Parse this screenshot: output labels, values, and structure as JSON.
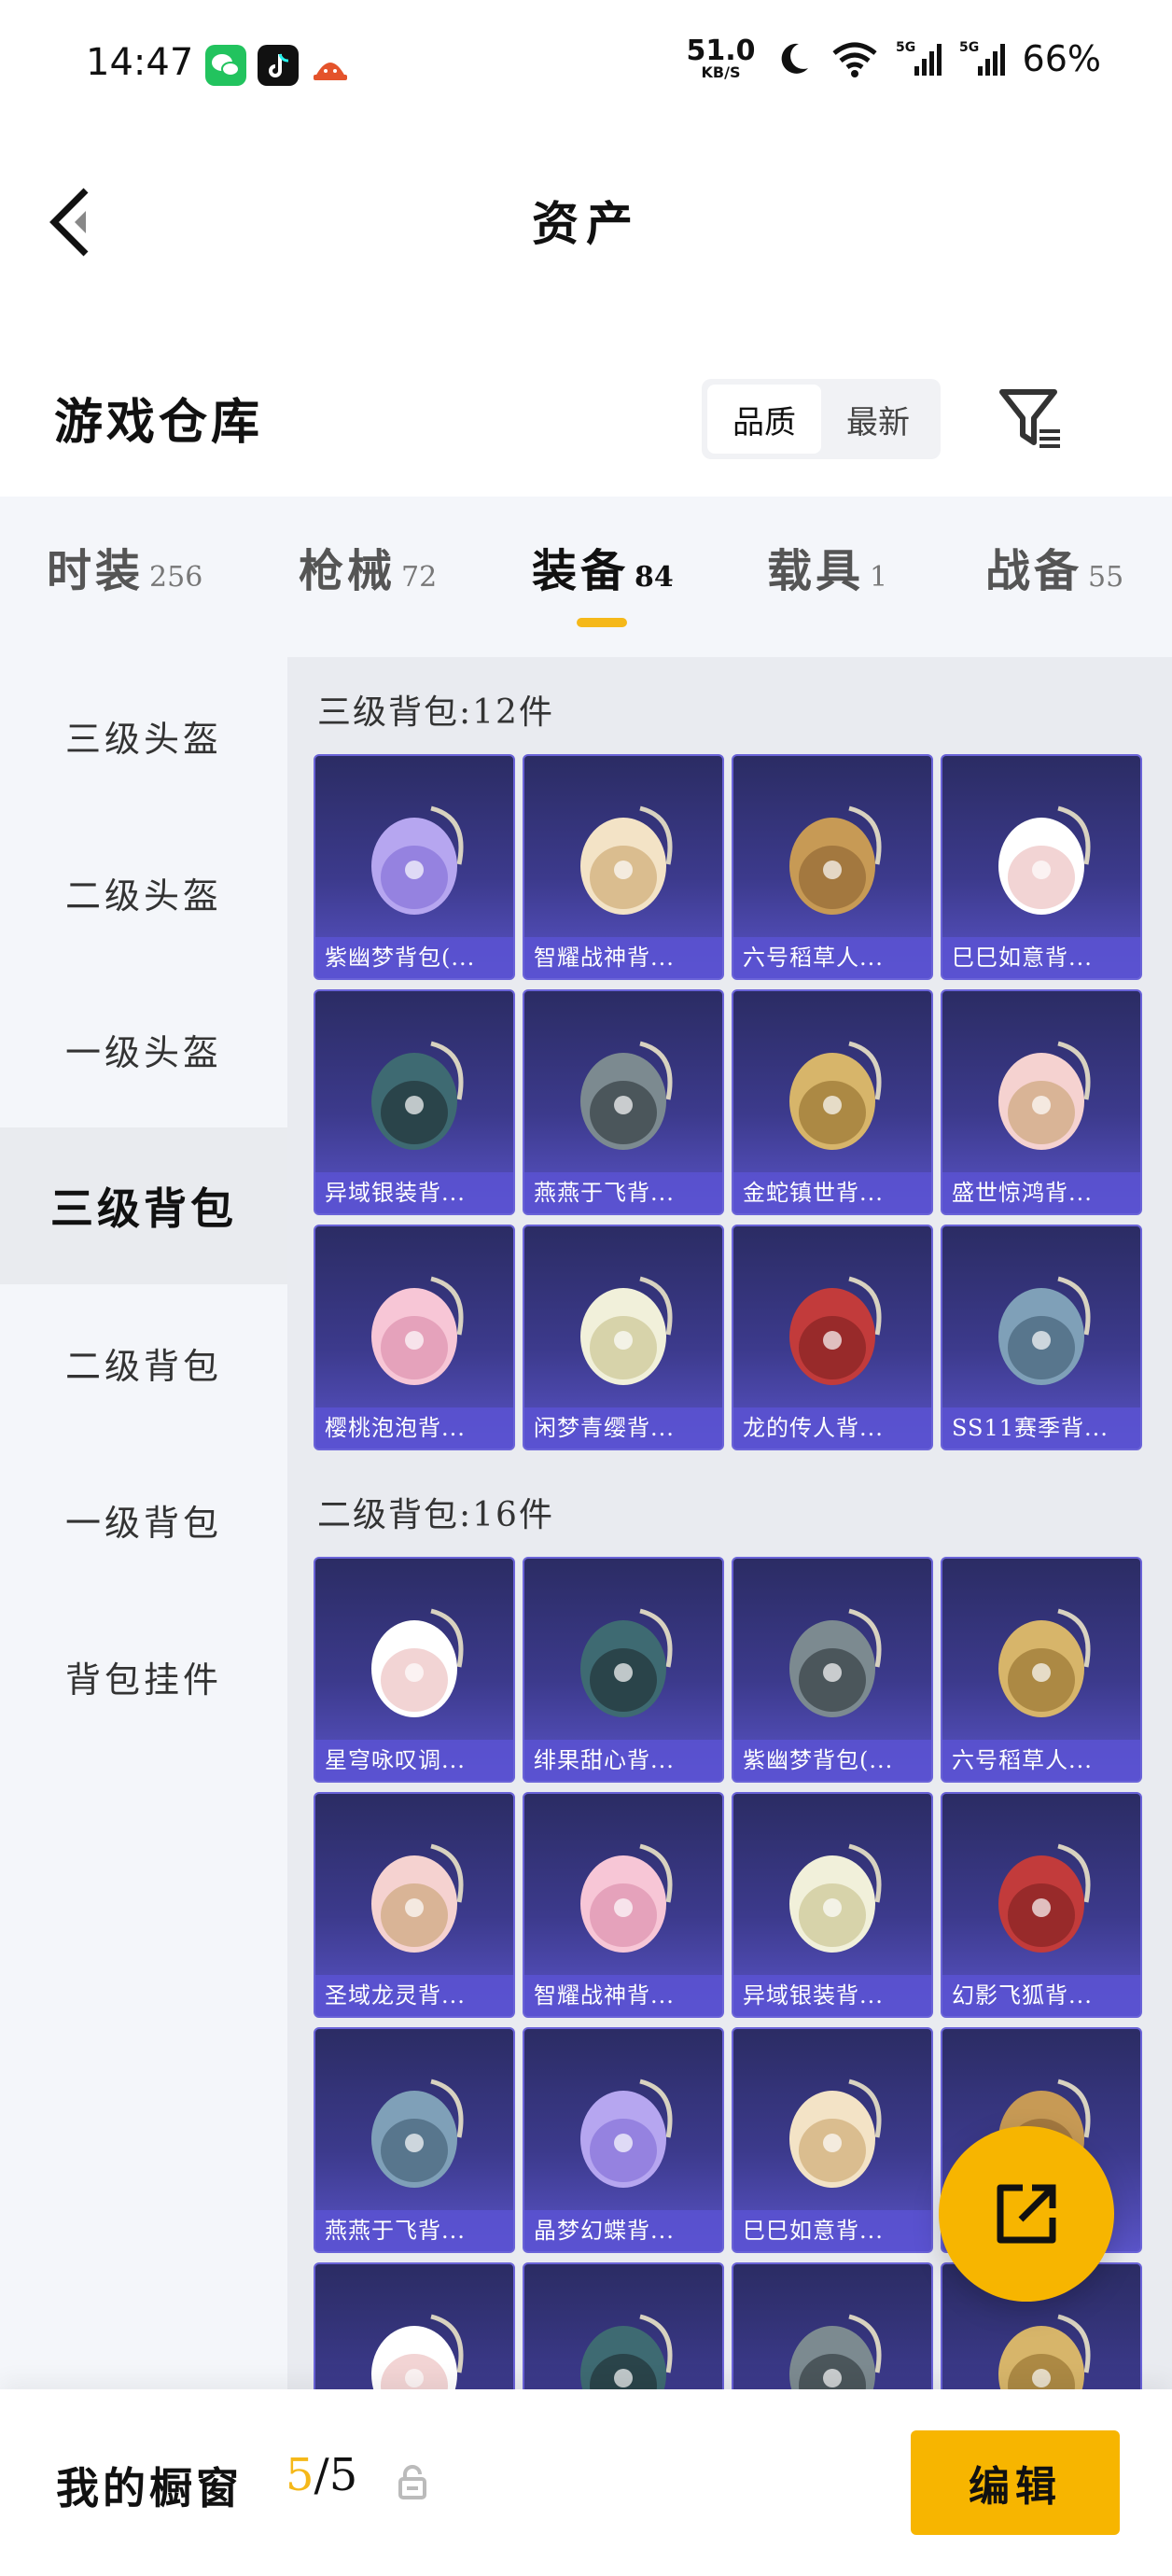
{
  "status_bar": {
    "time": "14:47",
    "net_speed": "51.0",
    "net_unit": "KB/S",
    "signal1": "5G",
    "signal2": "5G",
    "battery": "66%"
  },
  "header": {
    "title": "资产"
  },
  "warehouse": {
    "title": "游戏仓库",
    "sort_options": [
      "品质",
      "最新"
    ],
    "sort_active": "品质"
  },
  "category_tabs": [
    {
      "name": "时装",
      "count": "256"
    },
    {
      "name": "枪械",
      "count": "72"
    },
    {
      "name": "装备",
      "count": "84"
    },
    {
      "name": "载具",
      "count": "1"
    },
    {
      "name": "战备",
      "count": "55"
    }
  ],
  "active_tab": "装备",
  "sidebar": {
    "items": [
      "三级头盔",
      "二级头盔",
      "一级头盔",
      "三级背包",
      "二级背包",
      "一级背包",
      "背包挂件"
    ],
    "active": "三级背包"
  },
  "sections": [
    {
      "title": "三级背包:12件",
      "items": [
        "紫幽梦背包(...",
        "智耀战神背...",
        "六号稻草人...",
        "巳巳如意背...",
        "异域银装背...",
        "燕燕于飞背...",
        "金蛇镇世背...",
        "盛世惊鸿背...",
        "樱桃泡泡背...",
        "闲梦青缨背...",
        "龙的传人背...",
        "SS11赛季背..."
      ]
    },
    {
      "title": "二级背包:16件",
      "items": [
        "星穹咏叹调...",
        "绯果甜心背...",
        "紫幽梦背包(...",
        "六号稻草人...",
        "圣域龙灵背...",
        "智耀战神背...",
        "异域银装背...",
        "幻影飞狐背...",
        "燕燕于飞背...",
        "晶梦幻蝶背...",
        "巳巳如意背...",
        "",
        "",
        "",
        "",
        ""
      ]
    }
  ],
  "bottom": {
    "showcase_label": "我的橱窗",
    "showcase_current": "5",
    "showcase_total": "/5",
    "edit_label": "编辑"
  },
  "colors": {
    "accent": "#f7b500",
    "card_top": "#2b2c64",
    "card_bottom": "#5a54c8"
  }
}
